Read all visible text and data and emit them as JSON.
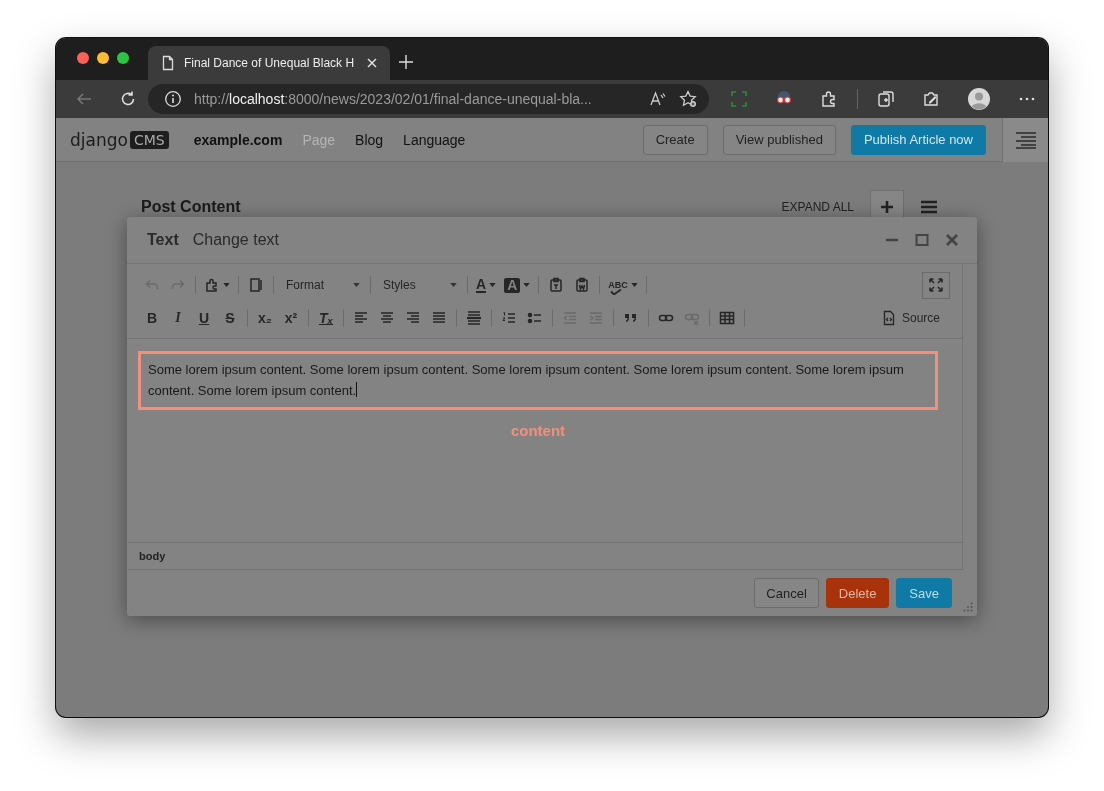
{
  "browser": {
    "tab_title": "Final Dance of Unequal Black H",
    "url": "http://**localhost**:8000/news/2023/02/01/final-dance-unequal-bla..."
  },
  "cms_toolbar": {
    "logo_word": "django",
    "logo_badge": "CMS",
    "site": "example.com",
    "menu": [
      {
        "label": "Page",
        "disabled": true
      },
      {
        "label": "Blog",
        "disabled": false
      },
      {
        "label": "Language",
        "disabled": false
      }
    ],
    "buttons": [
      {
        "label": "Create",
        "kind": "default"
      },
      {
        "label": "View published",
        "kind": "default"
      },
      {
        "label": "Publish Article now",
        "kind": "primary"
      }
    ]
  },
  "page": {
    "heading": "Post Content",
    "expand_all": "EXPAND ALL"
  },
  "modal": {
    "title": "Text",
    "subtitle": "Change text",
    "toolbar_rows": [
      [
        {
          "kind": "undo",
          "disabled": true
        },
        {
          "kind": "redo",
          "disabled": true
        },
        {
          "kind": "separator"
        },
        {
          "kind": "plugin",
          "disabled": false,
          "caret": true
        },
        {
          "kind": "separator"
        },
        {
          "kind": "showblocks",
          "disabled": false
        },
        {
          "kind": "separator"
        },
        {
          "kind": "combo",
          "label": "Format"
        },
        {
          "kind": "separator"
        },
        {
          "kind": "combo",
          "label": "Styles"
        },
        {
          "kind": "separator"
        },
        {
          "kind": "text-color",
          "glyph": "A",
          "disabled": false,
          "caret": true
        },
        {
          "kind": "bg-color",
          "glyph": "A",
          "disabled": false,
          "caret": true
        },
        {
          "kind": "separator"
        },
        {
          "kind": "paste-text",
          "disabled": false
        },
        {
          "kind": "paste-word",
          "disabled": false
        },
        {
          "kind": "separator"
        },
        {
          "kind": "spellcheck",
          "glyph": "ABC",
          "disabled": false,
          "caret": true
        },
        {
          "kind": "separator"
        },
        {
          "kind": "maximize",
          "disabled": false
        }
      ],
      [
        {
          "kind": "bold",
          "glyph": "B",
          "disabled": false
        },
        {
          "kind": "italic",
          "glyph": "I",
          "disabled": false
        },
        {
          "kind": "underline",
          "glyph": "U",
          "disabled": false
        },
        {
          "kind": "strike",
          "glyph": "S",
          "disabled": false
        },
        {
          "kind": "separator"
        },
        {
          "kind": "subscript",
          "glyph": "x₂",
          "disabled": false
        },
        {
          "kind": "superscript",
          "glyph": "x²",
          "disabled": false
        },
        {
          "kind": "separator"
        },
        {
          "kind": "clear-format",
          "glyph": "Tₓ",
          "disabled": false
        },
        {
          "kind": "separator"
        },
        {
          "kind": "align-left",
          "disabled": false
        },
        {
          "kind": "align-center",
          "disabled": false
        },
        {
          "kind": "align-right",
          "disabled": false
        },
        {
          "kind": "justify",
          "disabled": false
        },
        {
          "kind": "separator"
        },
        {
          "kind": "hr",
          "disabled": false
        },
        {
          "kind": "separator"
        },
        {
          "kind": "ol",
          "disabled": false
        },
        {
          "kind": "ul",
          "disabled": false
        },
        {
          "kind": "separator"
        },
        {
          "kind": "outdent",
          "disabled": true
        },
        {
          "kind": "indent",
          "disabled": true
        },
        {
          "kind": "separator"
        },
        {
          "kind": "blockquote",
          "disabled": false
        },
        {
          "kind": "separator"
        },
        {
          "kind": "link",
          "disabled": false
        },
        {
          "kind": "unlink",
          "disabled": true
        },
        {
          "kind": "separator"
        },
        {
          "kind": "table",
          "disabled": false
        },
        {
          "kind": "separator"
        },
        {
          "kind": "source",
          "label": "Source",
          "disabled": false
        }
      ]
    ],
    "content": "Some lorem ipsum content. Some lorem ipsum content. Some lorem ipsum content. Some lorem ipsum content. Some lorem ipsum content. Some lorem ipsum content.",
    "highlight_label": "content",
    "status_path": "body",
    "buttons": [
      {
        "label": "Cancel",
        "kind": "default"
      },
      {
        "label": "Delete",
        "kind": "danger"
      },
      {
        "label": "Save",
        "kind": "primary"
      }
    ]
  }
}
